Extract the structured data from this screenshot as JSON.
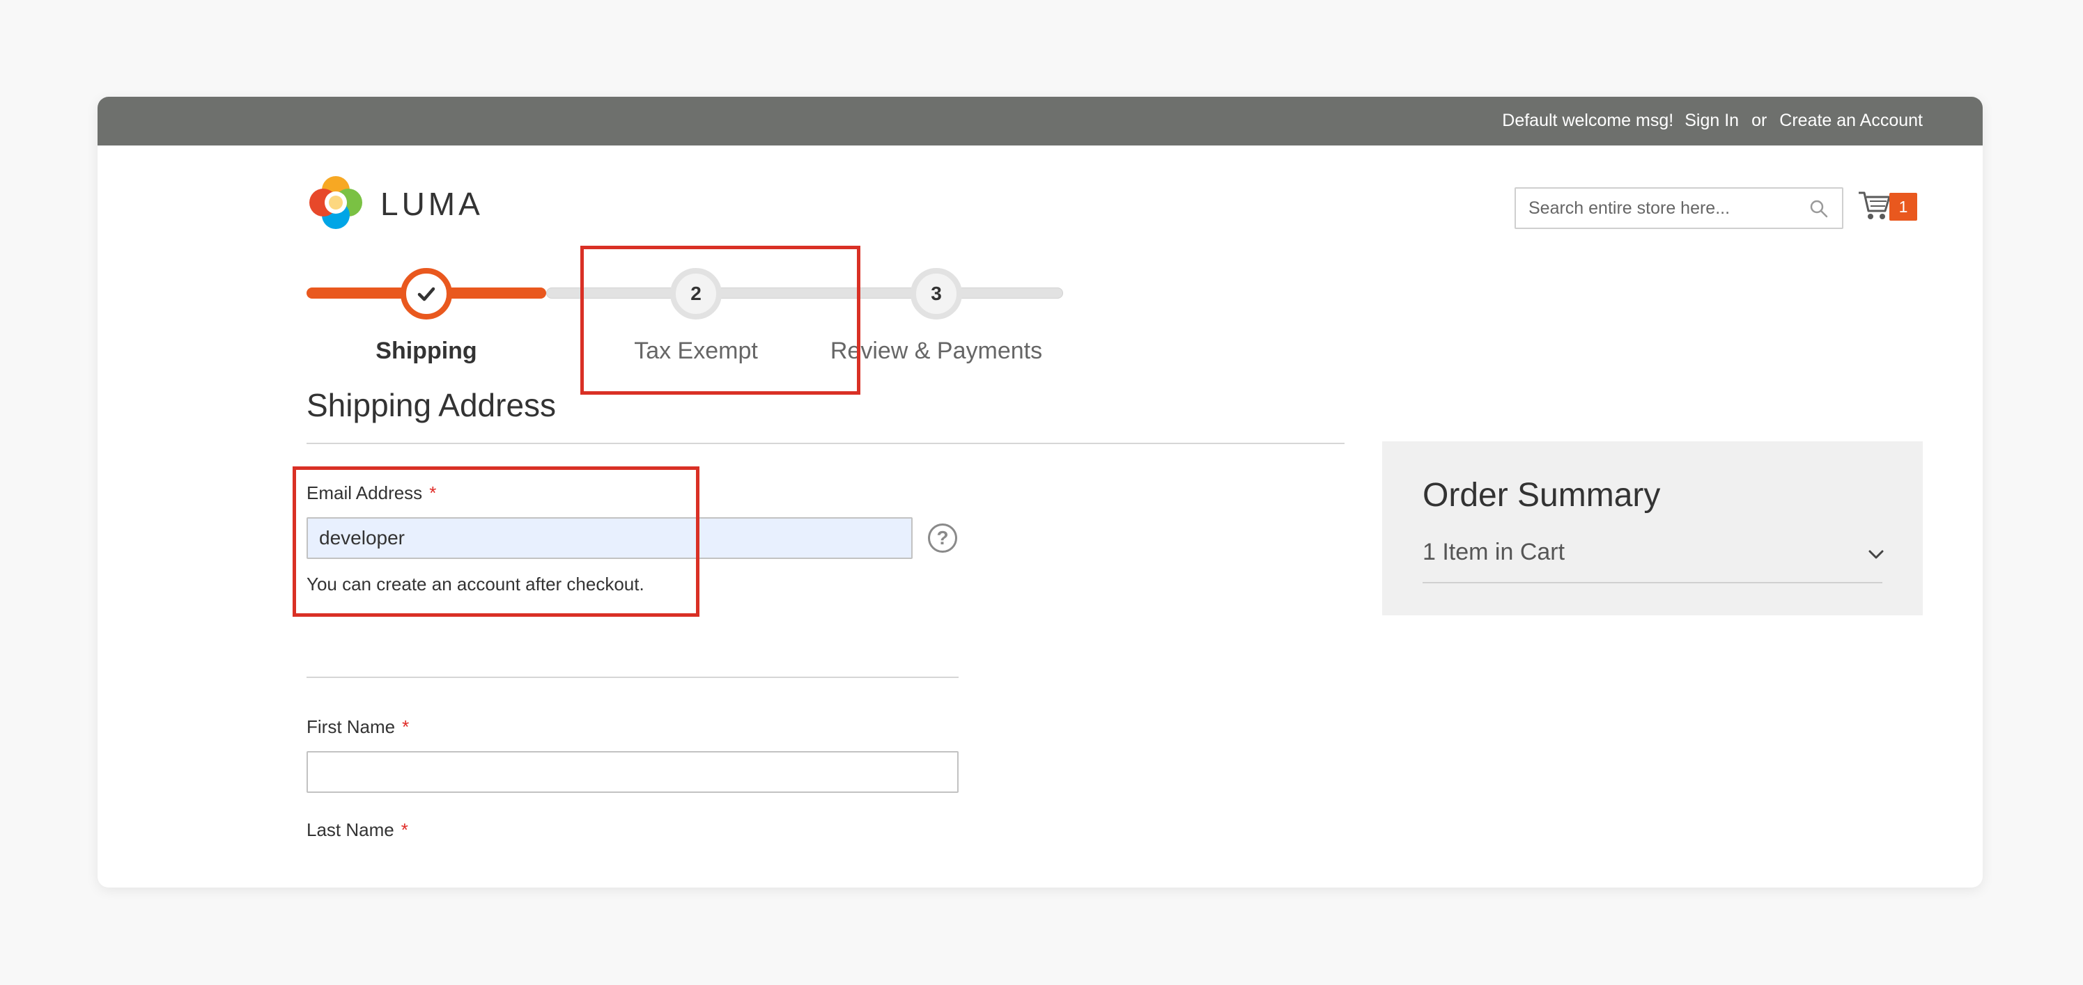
{
  "header": {
    "welcome": "Default welcome msg!",
    "sign_in": "Sign In",
    "or": "or",
    "create_account": "Create an Account"
  },
  "logo": {
    "text": "LUMA",
    "icon": "luma-logo-icon"
  },
  "search": {
    "placeholder": "Search entire store here...",
    "icon": "search-icon"
  },
  "cart": {
    "icon": "cart-icon",
    "count": "1"
  },
  "progress": {
    "steps": [
      {
        "number": "",
        "label": "Shipping",
        "state": "complete",
        "icon": "check-icon"
      },
      {
        "number": "2",
        "label": "Tax Exempt",
        "state": "pending"
      },
      {
        "number": "3",
        "label": "Review & Payments",
        "state": "pending"
      }
    ]
  },
  "shipping": {
    "title": "Shipping Address",
    "email": {
      "label": "Email Address",
      "required_marker": "*",
      "value": "developer",
      "note": "You can create an account after checkout.",
      "help_icon": "?"
    },
    "first_name": {
      "label": "First Name",
      "required_marker": "*",
      "value": ""
    },
    "last_name": {
      "label": "Last Name",
      "required_marker": "*"
    }
  },
  "summary": {
    "title": "Order Summary",
    "items": "1 Item in Cart",
    "icon": "chevron-down-icon"
  },
  "colors": {
    "accent": "#e9581e",
    "topbar": "#6e706d",
    "required": "#e02b27",
    "annotation": "#d93025"
  }
}
